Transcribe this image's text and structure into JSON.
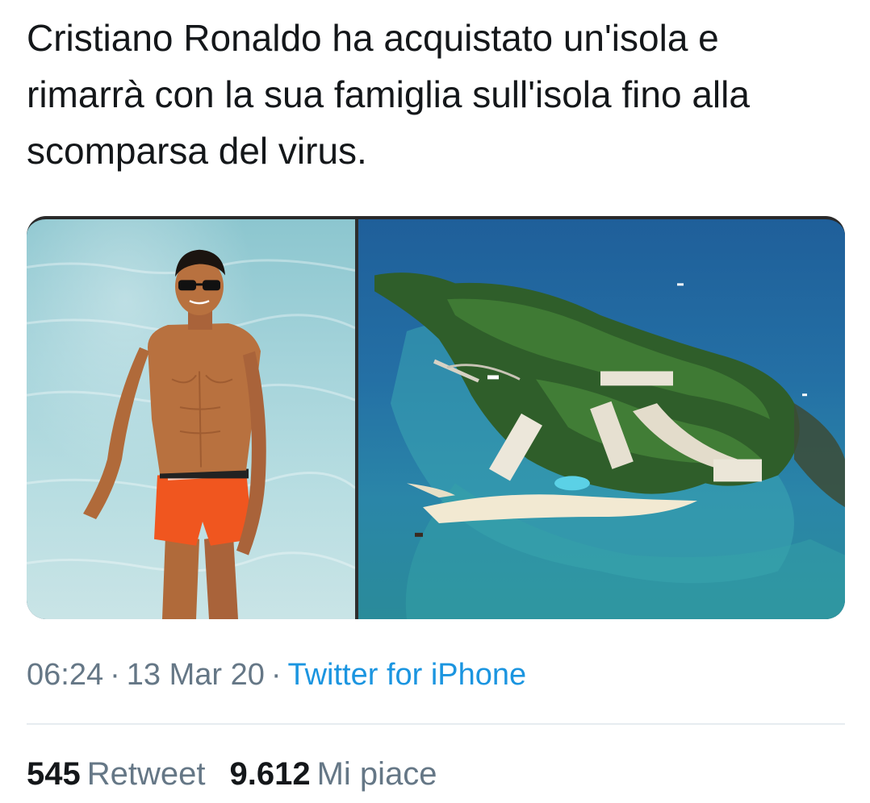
{
  "tweet": {
    "text": "Cristiano Ronaldo ha acquistato un'isola e rimarrà con la sua famiglia sull'isola fino alla scomparsa del virus.",
    "time": "06:24",
    "date": "13 Mar 20",
    "separator": "·",
    "source": "Twitter for iPhone"
  },
  "stats": {
    "retweets_count": "545",
    "retweets_label": "Retweet",
    "likes_count": "9.612",
    "likes_label": "Mi piace"
  },
  "colors": {
    "text": "#14171a",
    "secondary": "#657786",
    "link": "#1b95e0",
    "divider": "#e6ecf0"
  }
}
